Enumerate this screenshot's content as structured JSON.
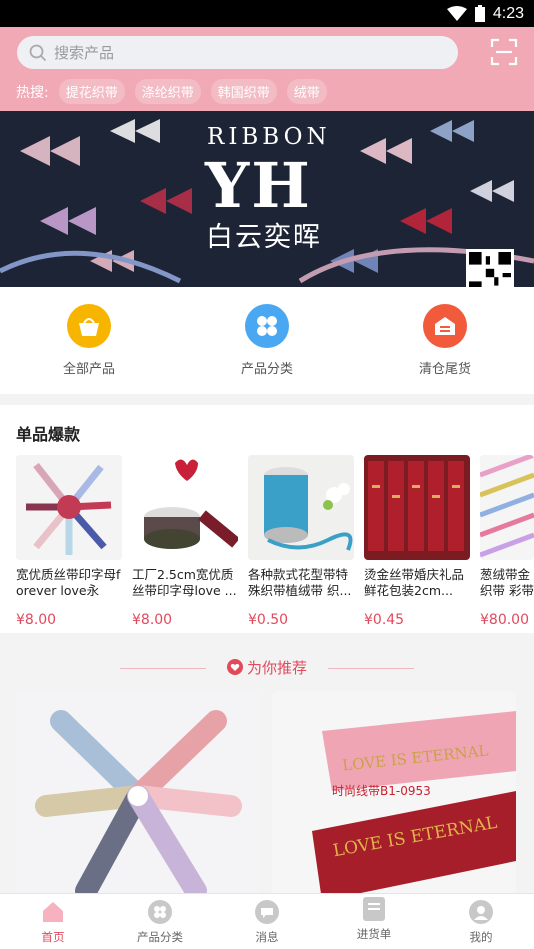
{
  "status_bar": {
    "time": "4:23"
  },
  "search": {
    "placeholder": "搜索产品"
  },
  "hot_search": {
    "label": "热搜:",
    "tags": [
      "提花织带",
      "涤纶织带",
      "韩国织带",
      "绒带"
    ]
  },
  "banner": {
    "brand_en": "RIBBON",
    "brand_logo": "YH",
    "brand_cn": "白云奕晖"
  },
  "categories": [
    {
      "label": "全部产品",
      "icon": "shopping-bag-icon",
      "color": "#f7b500"
    },
    {
      "label": "产品分类",
      "icon": "four-leaf-grid-icon",
      "color": "#4aa7f2"
    },
    {
      "label": "清仓尾货",
      "icon": "warehouse-icon",
      "color": "#f25a3c"
    }
  ],
  "hot_products": {
    "title": "单品爆款",
    "items": [
      {
        "name": "宽优质丝带印字母forever love永恒...",
        "price": "¥8.00"
      },
      {
        "name": "工厂2.5cm宽优质丝带印字母love ...",
        "price": "¥8.00"
      },
      {
        "name": "各种款式花型带特殊织带植绒带 织...",
        "price": "¥0.50"
      },
      {
        "name": "烫金丝带婚庆礼品鲜花包装2cm...",
        "price": "¥0.45"
      },
      {
        "name": "葱绒带金织带 彩带",
        "price": "¥80.00"
      }
    ]
  },
  "recommend": {
    "title": "为你推荐",
    "card2_caption": "时尚线带B1-0953",
    "card2_ribbon_text": "LOVE IS ETERNAL"
  },
  "tabbar": [
    {
      "label": "首页",
      "icon": "home-icon",
      "active": true
    },
    {
      "label": "产品分类",
      "icon": "category-icon",
      "active": false
    },
    {
      "label": "消息",
      "icon": "message-icon",
      "active": false
    },
    {
      "label": "进货单",
      "icon": "order-list-icon",
      "active": false
    },
    {
      "label": "我的",
      "icon": "profile-icon",
      "active": false
    }
  ],
  "colors": {
    "header": "#f0a9b5",
    "accent": "#e24a5c"
  }
}
